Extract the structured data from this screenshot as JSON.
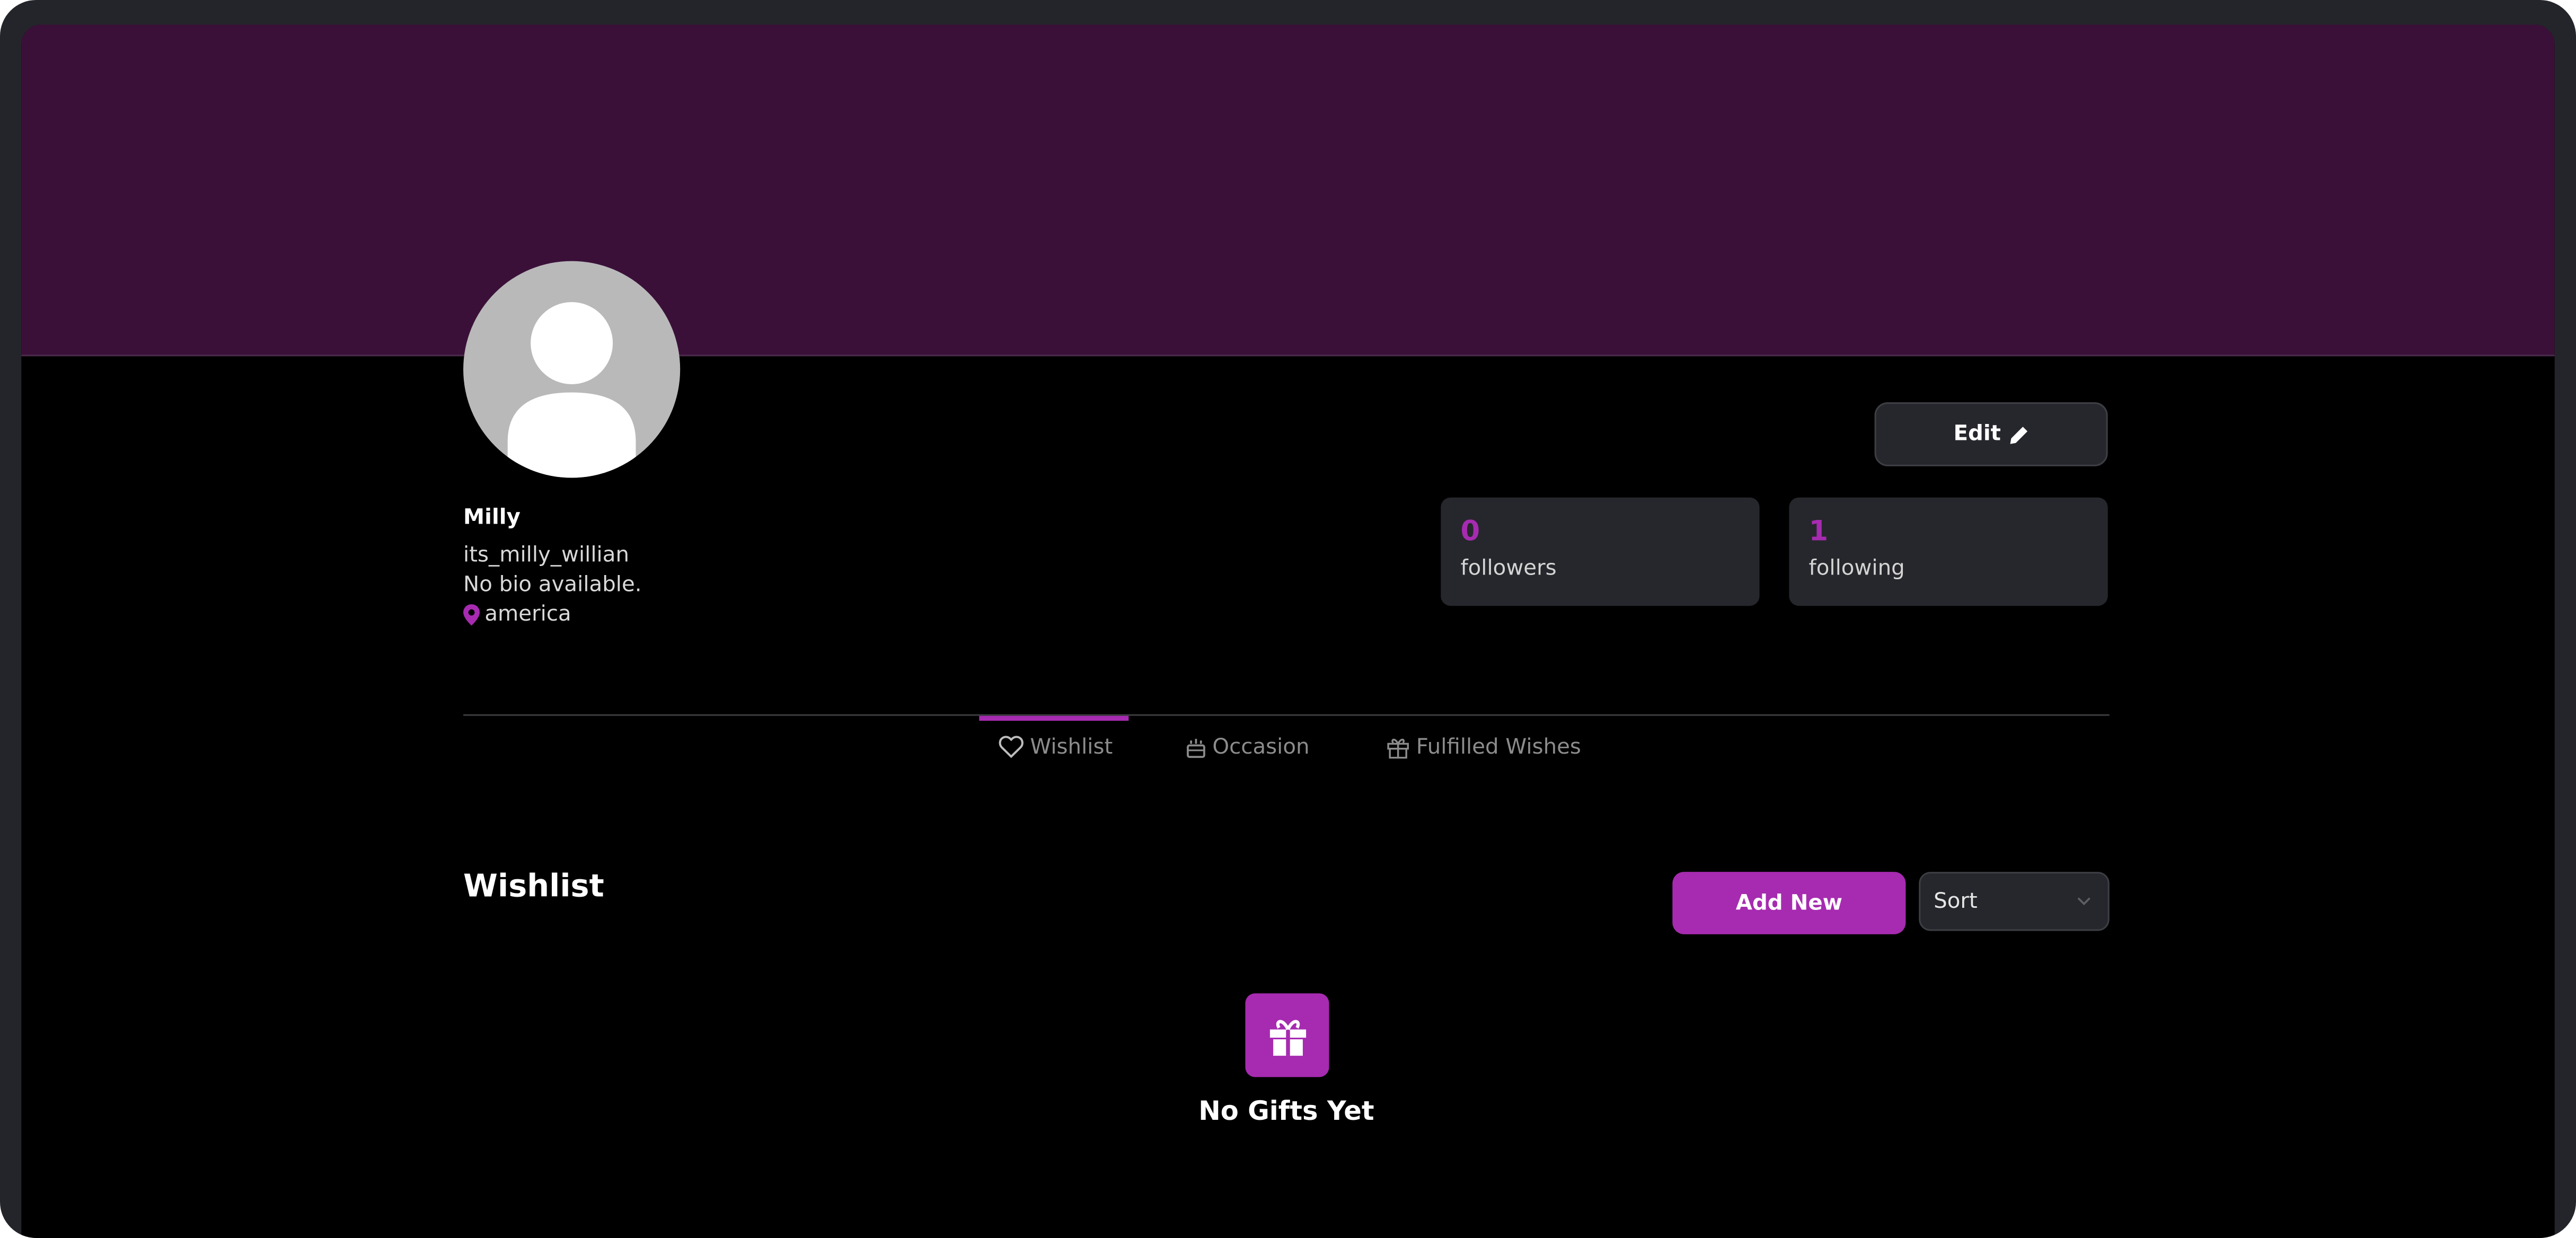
{
  "profile": {
    "name": "Milly",
    "username": "its_milly_willian",
    "bio": "No bio available.",
    "location": "america"
  },
  "actions": {
    "edit_label": "Edit"
  },
  "stats": {
    "followers": {
      "count": "0",
      "label": "followers"
    },
    "following": {
      "count": "1",
      "label": "following"
    }
  },
  "tabs": [
    {
      "label": "Wishlist",
      "icon": "heart-icon",
      "active": true
    },
    {
      "label": "Occasion",
      "icon": "cake-icon",
      "active": false
    },
    {
      "label": "Fulfilled Wishes",
      "icon": "gift-icon",
      "active": false
    }
  ],
  "wishlist": {
    "title": "Wishlist",
    "add_label": "Add New",
    "sort_label": "Sort",
    "empty_text": "No Gifts Yet"
  },
  "colors": {
    "banner": "#3a1039",
    "accent": "#a62bb0",
    "card": "#26272c",
    "background": "#000000"
  }
}
